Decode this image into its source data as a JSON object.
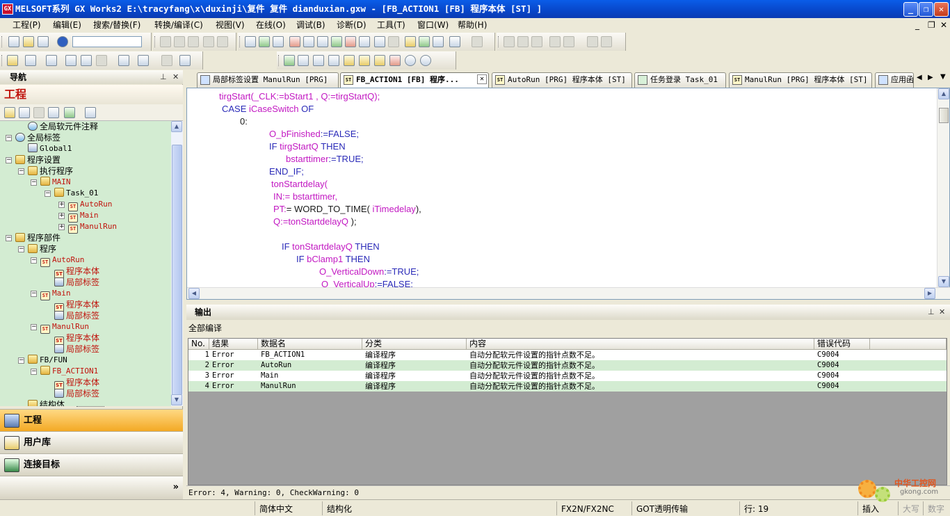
{
  "window": {
    "title": "MELSOFT系列 GX Works2 E:\\tracyfang\\x\\duxinji\\复件 复件 dianduxian.gxw - [FB_ACTION1 [FB] 程序本体 [ST] ]",
    "app_icon": "GX",
    "controls": {
      "minimize": "_",
      "restore": "❐",
      "close": "✕"
    }
  },
  "menu": [
    "工程(P)",
    "编辑(E)",
    "搜索/替换(F)",
    "转换/编译(C)",
    "视图(V)",
    "在线(O)",
    "调试(B)",
    "诊断(D)",
    "工具(T)",
    "窗口(W)",
    "帮助(H)"
  ],
  "mdi_controls": {
    "minimize": "_",
    "restore": "❐",
    "close": "✕"
  },
  "navigation": {
    "header": "导航",
    "title": "工程",
    "tree": [
      {
        "label": "全局软元件注释",
        "level": 1,
        "icon": "globe-icon",
        "style": "normal"
      },
      {
        "label": "全局标签",
        "level": 0,
        "icon": "globe-icon",
        "style": "normal",
        "expander": "−"
      },
      {
        "label": "Global1",
        "level": 1,
        "icon": "table-icon",
        "style": "mono"
      },
      {
        "label": "程序设置",
        "level": 0,
        "icon": "folder-icon",
        "style": "normal",
        "expander": "−"
      },
      {
        "label": "执行程序",
        "level": 1,
        "icon": "folder-icon",
        "style": "normal",
        "expander": "−"
      },
      {
        "label": "MAIN",
        "level": 2,
        "icon": "folder-icon",
        "style": "red",
        "expander": "−"
      },
      {
        "label": "Task_01",
        "level": 3,
        "icon": "folder-icon",
        "style": "mono",
        "expander": "−"
      },
      {
        "label": "AutoRun",
        "level": 4,
        "icon": "st-icon",
        "style": "red",
        "expander": "+"
      },
      {
        "label": "Main",
        "level": 4,
        "icon": "st-icon",
        "style": "red",
        "expander": "+"
      },
      {
        "label": "ManulRun",
        "level": 4,
        "icon": "st-icon",
        "style": "red",
        "expander": "+"
      },
      {
        "label": "程序部件",
        "level": 0,
        "icon": "folder-icon",
        "style": "normal",
        "expander": "−"
      },
      {
        "label": "程序",
        "level": 1,
        "icon": "folder-icon",
        "style": "normal",
        "expander": "−"
      },
      {
        "label": "AutoRun",
        "level": 2,
        "icon": "st-icon",
        "style": "red",
        "expander": "−"
      },
      {
        "label": "程序本体",
        "level": 3,
        "icon": "st-icon",
        "style": "redz"
      },
      {
        "label": "局部标签",
        "level": 3,
        "icon": "table-icon",
        "style": "redz"
      },
      {
        "label": "Main",
        "level": 2,
        "icon": "st-icon",
        "style": "red",
        "expander": "−"
      },
      {
        "label": "程序本体",
        "level": 3,
        "icon": "st-icon",
        "style": "redz"
      },
      {
        "label": "局部标签",
        "level": 3,
        "icon": "table-icon",
        "style": "redz"
      },
      {
        "label": "ManulRun",
        "level": 2,
        "icon": "st-icon",
        "style": "red",
        "expander": "−"
      },
      {
        "label": "程序本体",
        "level": 3,
        "icon": "st-icon",
        "style": "redz"
      },
      {
        "label": "局部标签",
        "level": 3,
        "icon": "table-icon",
        "style": "redz"
      },
      {
        "label": "FB/FUN",
        "level": 1,
        "icon": "folder-icon",
        "style": "mono",
        "expander": "−"
      },
      {
        "label": "FB_ACTION1",
        "level": 2,
        "icon": "folder-icon",
        "style": "red",
        "expander": "−"
      },
      {
        "label": "程序本体",
        "level": 3,
        "icon": "st-icon",
        "style": "redz"
      },
      {
        "label": "局部标签",
        "level": 3,
        "icon": "table-icon",
        "style": "redz"
      },
      {
        "label": "结构体",
        "level": 1,
        "icon": "folder-icon",
        "style": "normal"
      }
    ],
    "buttons": [
      "工程",
      "用户库",
      "连接目标"
    ],
    "more": "»"
  },
  "tabs": [
    {
      "label": "局部标签设置 ManulRun [PRG]",
      "active": false
    },
    {
      "label": "FB_ACTION1 [FB] 程序...",
      "active": true
    },
    {
      "label": "AutoRun [PRG] 程序本体 [ST]",
      "active": false
    },
    {
      "label": "任务登录 Task_01",
      "active": false
    },
    {
      "label": "ManulRun [PRG] 程序本体 [ST]",
      "active": false
    },
    {
      "label": "应用函",
      "active": false
    }
  ],
  "code_lines": [
    [
      {
        "t": "tirgStart(_CLK:=bStart1 , Q:=tirgStartQ);",
        "c": "m"
      }
    ],
    [
      {
        "t": "CASE ",
        "c": "k"
      },
      {
        "t": "iCaseSwitch ",
        "c": "m"
      },
      {
        "t": "OF",
        "c": "k"
      }
    ],
    [
      {
        "t": "0:",
        "c": "t"
      }
    ],
    [
      {
        "t": "O_bFinished",
        "c": "m"
      },
      {
        "t": ":=FALSE;",
        "c": "k"
      }
    ],
    [
      {
        "t": "IF ",
        "c": "k"
      },
      {
        "t": "tirgStartQ ",
        "c": "m"
      },
      {
        "t": "THEN",
        "c": "k"
      }
    ],
    [
      {
        "t": "bstarttimer",
        "c": "m"
      },
      {
        "t": ":=TRUE;",
        "c": "k"
      }
    ],
    [
      {
        "t": "END_IF;",
        "c": "k"
      }
    ],
    [
      {
        "t": "tonStartdelay(",
        "c": "m"
      }
    ],
    [
      {
        "t": "IN:",
        "c": "m"
      },
      {
        "t": "= bstarttimer,",
        "c": "m"
      }
    ],
    [
      {
        "t": "PT:",
        "c": "m"
      },
      {
        "t": "= WORD_TO_TIME( ",
        "c": "t"
      },
      {
        "t": "iTimedelay",
        "c": "m"
      },
      {
        "t": "),",
        "c": "t"
      }
    ],
    [
      {
        "t": "Q:=tonStartdelayQ ",
        "c": "m"
      },
      {
        "t": ");",
        "c": "t"
      }
    ],
    [],
    [
      {
        "t": "IF ",
        "c": "k"
      },
      {
        "t": "tonStartdelayQ ",
        "c": "m"
      },
      {
        "t": "THEN",
        "c": "k"
      }
    ],
    [
      {
        "t": "IF ",
        "c": "k"
      },
      {
        "t": "bClamp1 ",
        "c": "m"
      },
      {
        "t": "THEN",
        "c": "k"
      }
    ],
    [
      {
        "t": "O_VerticalDown",
        "c": "m"
      },
      {
        "t": ":=TRUE;",
        "c": "k"
      }
    ],
    [
      {
        "t": "O_VerticalUp",
        "c": "m"
      },
      {
        "t": ":=FALSE;",
        "c": "k"
      }
    ]
  ],
  "output": {
    "header": "输出",
    "subtitle": "全部编译",
    "columns": [
      "No.",
      "结果",
      "数据名",
      "分类",
      "内容",
      "错误代码"
    ],
    "rows": [
      {
        "no": "1",
        "result": "Error",
        "data": "FB_ACTION1",
        "category": "编译程序",
        "content": "自动分配软元件设置的指针点数不足。",
        "code": "C9004"
      },
      {
        "no": "2",
        "result": "Error",
        "data": "AutoRun",
        "category": "编译程序",
        "content": "自动分配软元件设置的指针点数不足。",
        "code": "C9004"
      },
      {
        "no": "3",
        "result": "Error",
        "data": "Main",
        "category": "编译程序",
        "content": "自动分配软元件设置的指针点数不足。",
        "code": "C9004"
      },
      {
        "no": "4",
        "result": "Error",
        "data": "ManulRun",
        "category": "编译程序",
        "content": "自动分配软元件设置的指针点数不足。",
        "code": "C9004"
      }
    ],
    "summary": "Error: 4, Warning: 0, CheckWarning: 0"
  },
  "status": {
    "language": "简体中文",
    "mode": "结构化",
    "plc": "FX2N/FX2NC",
    "transfer": "GOT透明传输",
    "line": "行: 19",
    "insert": "插入",
    "caps": "大写",
    "num": "数字"
  },
  "watermark": {
    "title": "中华工控网",
    "url": "gkong.com"
  }
}
